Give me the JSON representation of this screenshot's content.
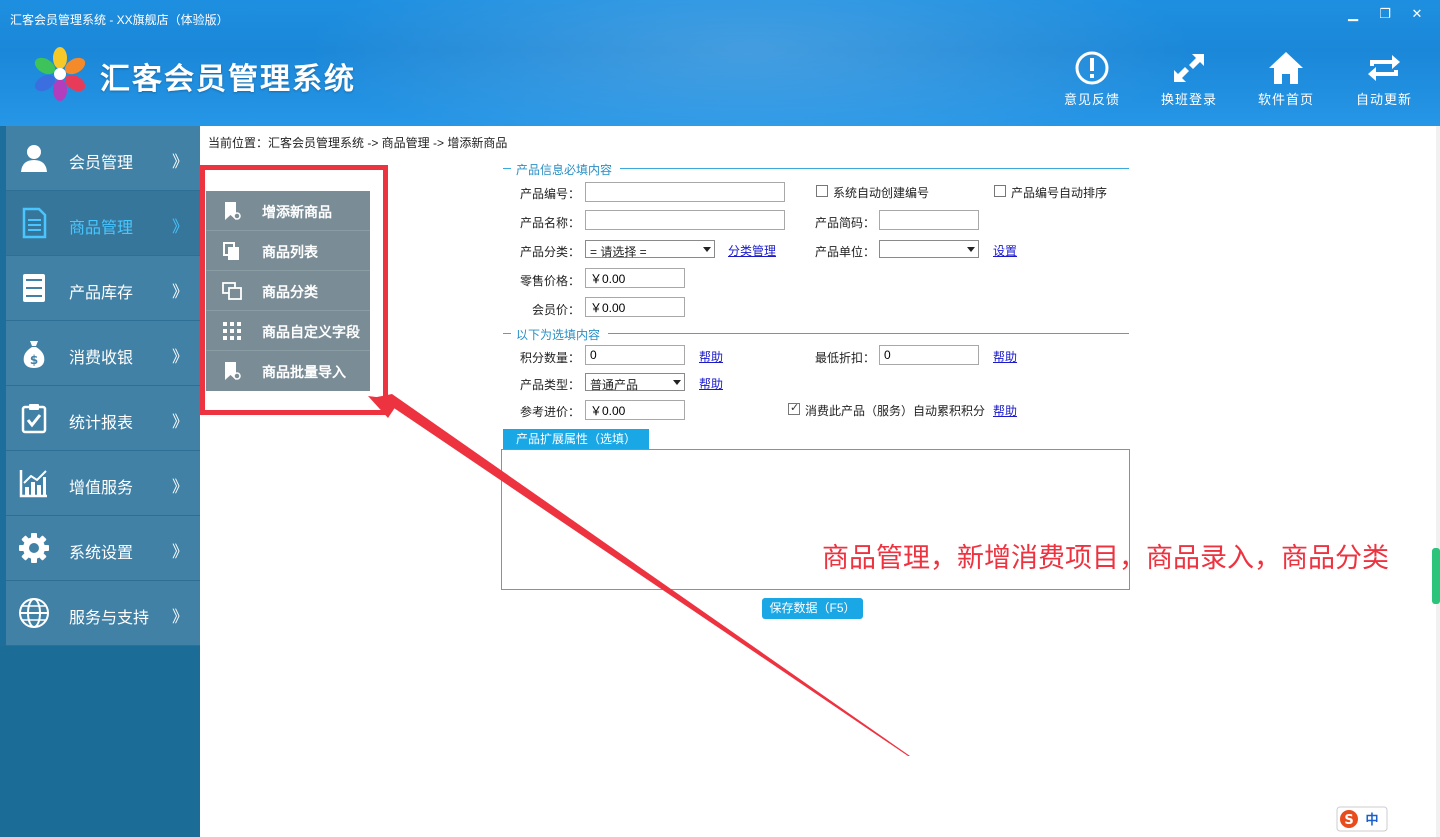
{
  "window": {
    "title": "汇客会员管理系统 - XX旗舰店（体验版）"
  },
  "header": {
    "app_name": "汇客会员管理系统",
    "actions": [
      {
        "label": "意见反馈",
        "icon": "feedback-icon"
      },
      {
        "label": "换班登录",
        "icon": "switch-shift-icon"
      },
      {
        "label": "软件首页",
        "icon": "home-icon"
      },
      {
        "label": "自动更新",
        "icon": "refresh-icon"
      }
    ]
  },
  "sidebar": {
    "items": [
      {
        "label": "会员管理",
        "icon": "member-icon",
        "arrow": "》"
      },
      {
        "label": "商品管理",
        "icon": "document-icon",
        "arrow": "》",
        "active": true
      },
      {
        "label": "产品库存",
        "icon": "cabinet-icon",
        "arrow": "》"
      },
      {
        "label": "消费收银",
        "icon": "money-bag-icon",
        "arrow": "》"
      },
      {
        "label": "统计报表",
        "icon": "clipboard-icon",
        "arrow": "》"
      },
      {
        "label": "增值服务",
        "icon": "growth-chart-icon",
        "arrow": "》"
      },
      {
        "label": "系统设置",
        "icon": "gear-icon",
        "arrow": "》"
      },
      {
        "label": "服务与支持",
        "icon": "globe-icon",
        "arrow": "》"
      }
    ]
  },
  "submenu": {
    "items": [
      {
        "label": "增添新商品",
        "icon": "bookmark-icon"
      },
      {
        "label": "商品列表",
        "icon": "copy-icon"
      },
      {
        "label": "商品分类",
        "icon": "windows-icon"
      },
      {
        "label": "商品自定义字段",
        "icon": "grid-icon"
      },
      {
        "label": "商品批量导入",
        "icon": "bookmark-icon"
      }
    ]
  },
  "breadcrumb": "当前位置：汇客会员管理系统 -> 商品管理 -> 增添新商品",
  "form": {
    "required_title": "产品信息必填内容",
    "optional_title": "以下为选填内容",
    "product_code": {
      "label": "产品编号：",
      "value": ""
    },
    "auto_code": {
      "label": "系统自动创建编号",
      "checked": false
    },
    "code_sort": {
      "label": "产品编号自动排序",
      "checked": false
    },
    "product_name": {
      "label": "产品名称：",
      "value": ""
    },
    "short_code": {
      "label": "产品简码：",
      "value": ""
    },
    "category": {
      "label": "产品分类：",
      "value": "= 请选择 =",
      "link": "分类管理"
    },
    "unit": {
      "label": "产品单位：",
      "value": "",
      "link": "设置"
    },
    "retail_price": {
      "label": "零售价格：",
      "value": "￥0.00"
    },
    "member_price": {
      "label": "会员价：",
      "value": "￥0.00"
    },
    "points": {
      "label": "积分数量：",
      "value": "0",
      "link": "帮助"
    },
    "min_discount": {
      "label": "最低折扣：",
      "value": "0",
      "link": "帮助"
    },
    "product_type": {
      "label": "产品类型：",
      "value": "普通产品",
      "link": "帮助"
    },
    "ref_cost": {
      "label": "参考进价：",
      "value": "￥0.00"
    },
    "auto_points": {
      "label": "消费此产品（服务）自动累积积分",
      "checked": true,
      "link": "帮助"
    },
    "ext_tab": "产品扩展属性（选填）",
    "save": "保存数据（F5）"
  },
  "annotation": "商品管理，新增消费项目，商品录入，商品分类",
  "ime": {
    "label": "中"
  },
  "colors": {
    "header": "#1e8fe0",
    "sidebar": "#4181a6",
    "accent": "#1aa7e6",
    "annotation": "#ee3340"
  }
}
